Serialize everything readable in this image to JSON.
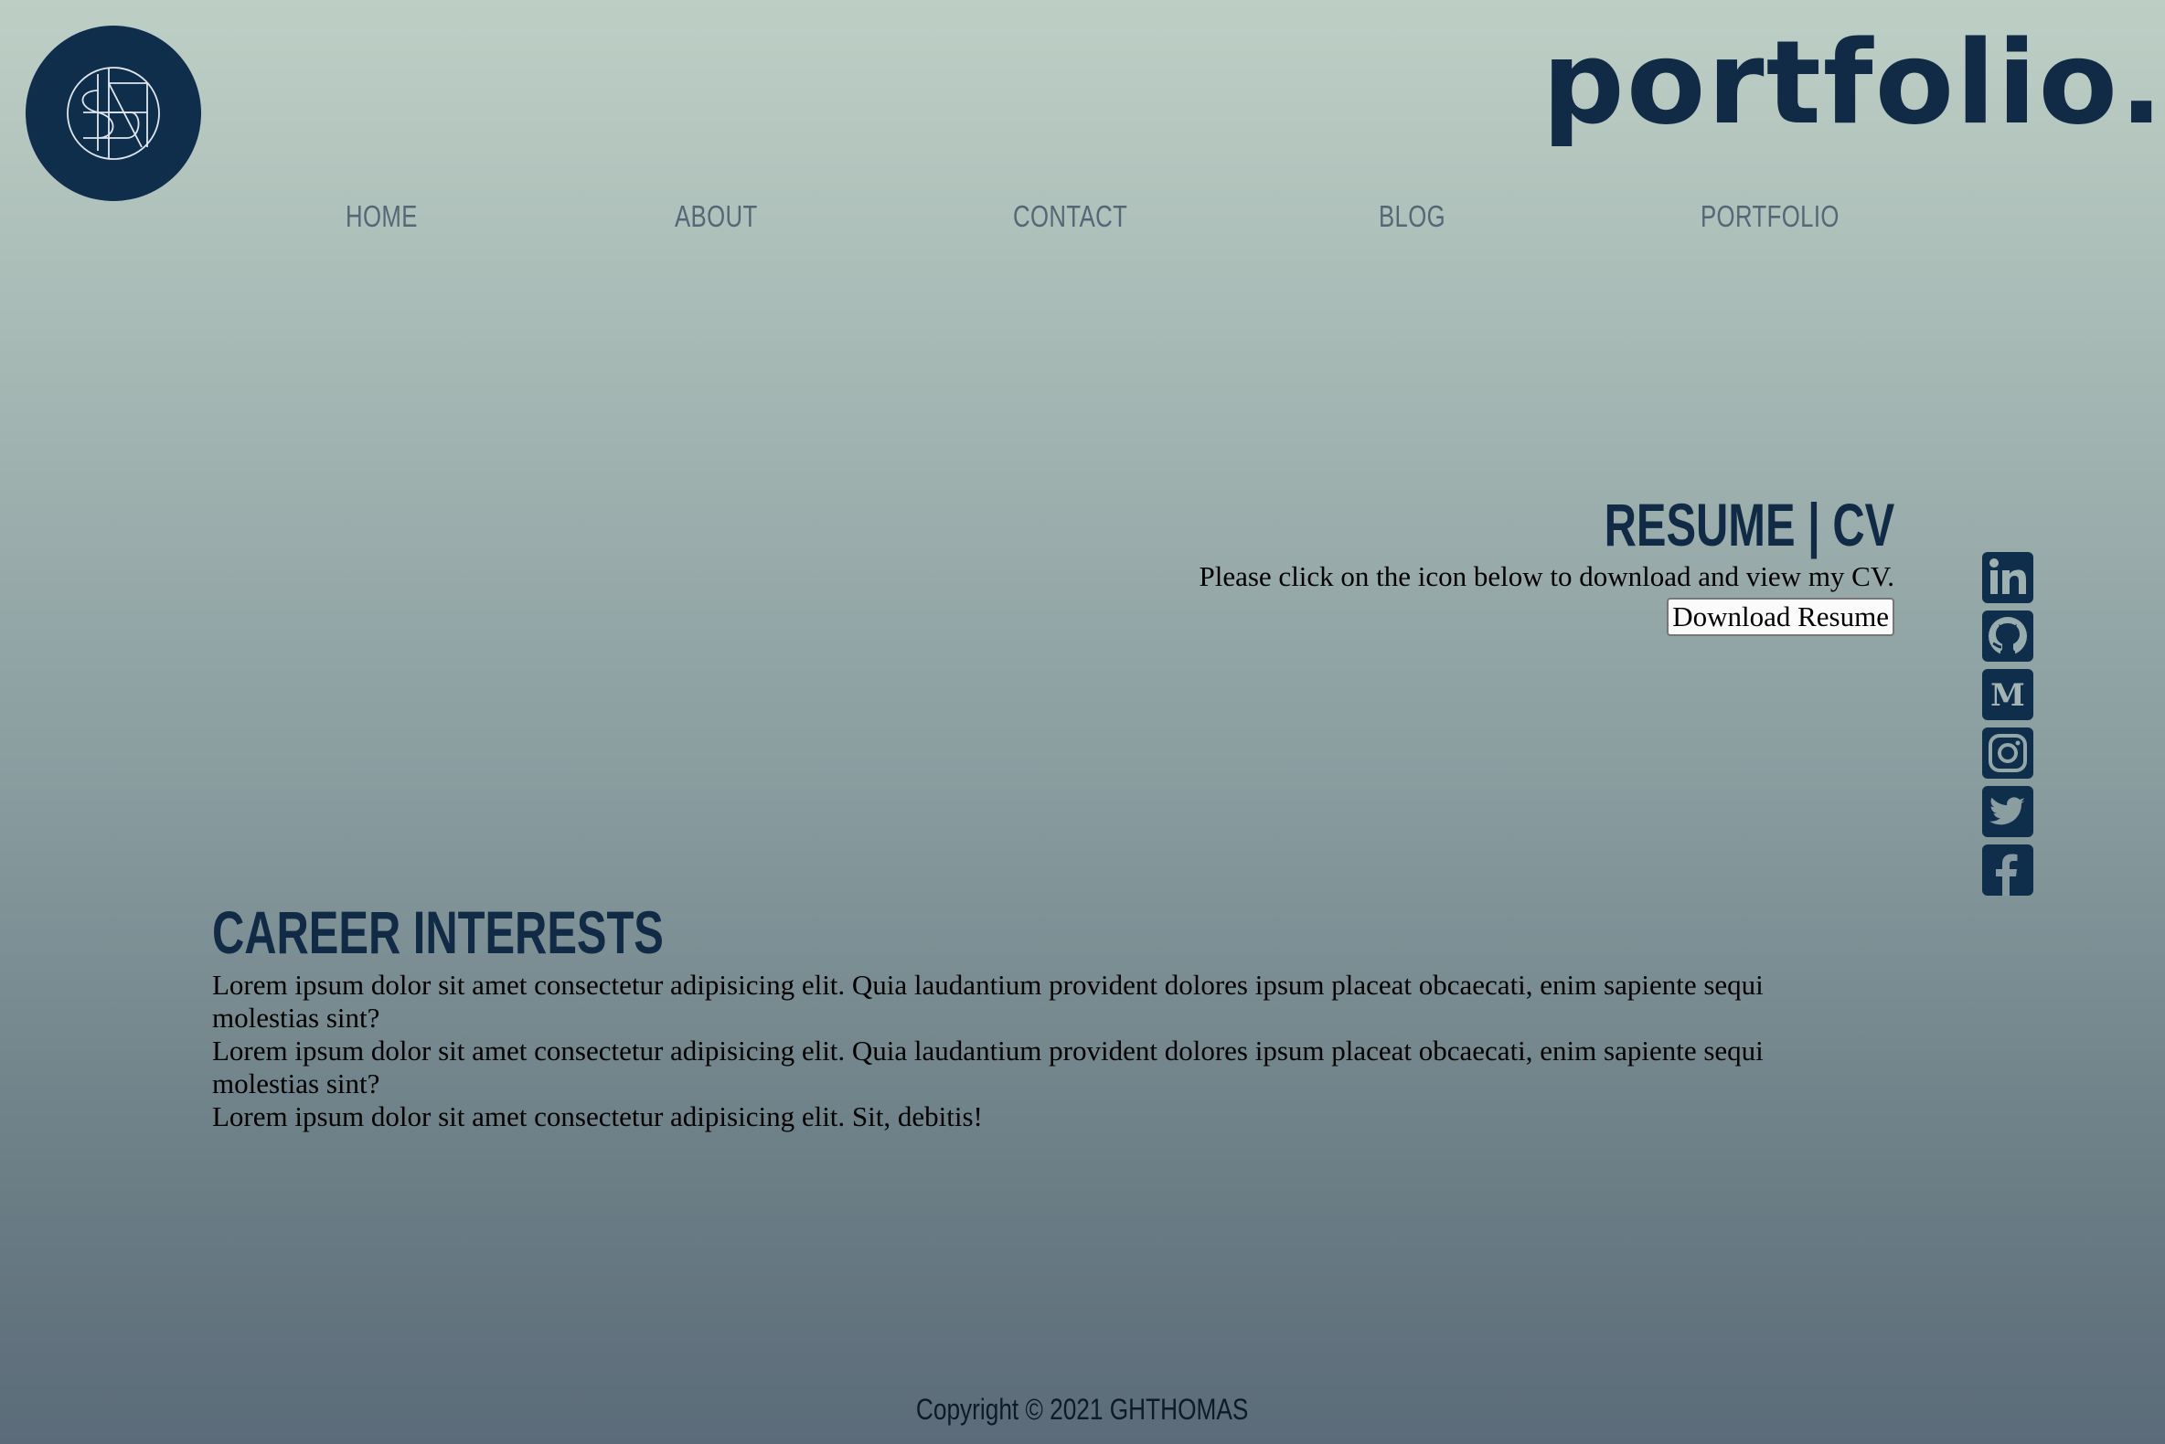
{
  "header": {
    "logo_icon": "sn-monogram-icon",
    "brand": "portfolio."
  },
  "nav": [
    {
      "label": "HOME"
    },
    {
      "label": "ABOUT"
    },
    {
      "label": "CONTACT"
    },
    {
      "label": "BLOG"
    },
    {
      "label": "PORTFOLIO"
    }
  ],
  "resume": {
    "title": "RESUME | CV",
    "text": "Please click on the icon below to download and view my CV.",
    "button": "Download Resume"
  },
  "social": [
    {
      "icon": "linkedin-icon"
    },
    {
      "icon": "github-icon"
    },
    {
      "icon": "medium-icon"
    },
    {
      "icon": "instagram-icon"
    },
    {
      "icon": "twitter-icon"
    },
    {
      "icon": "facebook-icon"
    }
  ],
  "career": {
    "title": "CAREER INTERESTS",
    "paragraphs": [
      "Lorem ipsum dolor sit amet consectetur adipisicing elit. Quia laudantium provident dolores ipsum placeat obcaecati, enim sapiente sequi molestias sint?",
      "Lorem ipsum dolor sit amet consectetur adipisicing elit. Quia laudantium provident dolores ipsum placeat obcaecati, enim sapiente sequi molestias sint?",
      "Lorem ipsum dolor sit amet consectetur adipisicing elit. Sit, debitis!"
    ]
  },
  "footer": {
    "copyright": "Copyright © 2021 GHTHOMAS"
  },
  "colors": {
    "navy": "#0f2e4c",
    "nav_text": "#556776",
    "bg_top": "#bdcfc5",
    "bg_bottom": "#5b6b79"
  }
}
